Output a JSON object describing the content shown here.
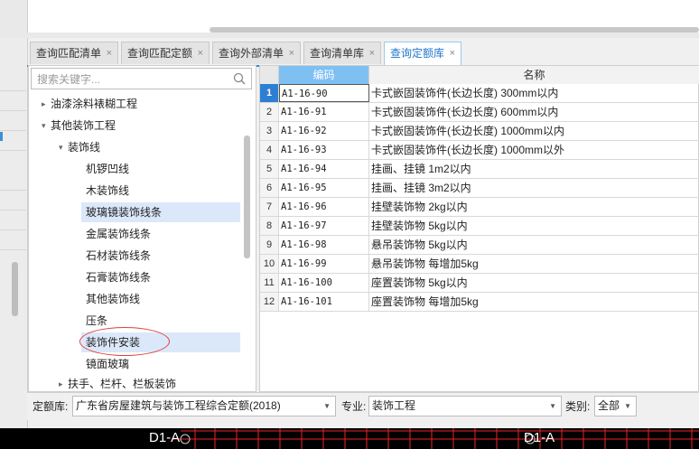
{
  "tabs": [
    {
      "label": "查询匹配清单",
      "active": false
    },
    {
      "label": "查询匹配定额",
      "active": false
    },
    {
      "label": "查询外部清单",
      "active": false
    },
    {
      "label": "查询清单库",
      "active": false
    },
    {
      "label": "查询定额库",
      "active": true
    }
  ],
  "tab_close_glyph": "×",
  "search": {
    "placeholder": "搜索关键字..."
  },
  "tree": [
    {
      "label": "油漆涂料裱糊工程",
      "level": 1,
      "arrow": "▸"
    },
    {
      "label": "其他装饰工程",
      "level": 1,
      "arrow": "▾"
    },
    {
      "label": "装饰线",
      "level": 2,
      "arrow": "▾"
    },
    {
      "label": "机锣凹线",
      "level": 3
    },
    {
      "label": "木装饰线",
      "level": 3
    },
    {
      "label": "玻璃镜装饰线条",
      "level": 3,
      "selected": true
    },
    {
      "label": "金属装饰线条",
      "level": 3
    },
    {
      "label": "石材装饰线条",
      "level": 3
    },
    {
      "label": "石膏装饰线条",
      "level": 3
    },
    {
      "label": "其他装饰线",
      "level": 3
    },
    {
      "label": "压条",
      "level": 3
    },
    {
      "label": "装饰件安装",
      "level": 3,
      "selected": true,
      "circled": true
    },
    {
      "label": "镜面玻璃",
      "level": 3
    },
    {
      "label": "扶手、栏杆、栏板装饰",
      "level": 2,
      "arrow": "▸"
    }
  ],
  "grid": {
    "headers": {
      "code": "编码",
      "name": "名称"
    },
    "current_row": 1,
    "rows": [
      {
        "num": "1",
        "code": "A1-16-90",
        "name": "卡式嵌固装饰件(长边长度) 300mm以内"
      },
      {
        "num": "2",
        "code": "A1-16-91",
        "name": "卡式嵌固装饰件(长边长度) 600mm以内"
      },
      {
        "num": "3",
        "code": "A1-16-92",
        "name": "卡式嵌固装饰件(长边长度) 1000mm以内"
      },
      {
        "num": "4",
        "code": "A1-16-93",
        "name": "卡式嵌固装饰件(长边长度) 1000mm以外"
      },
      {
        "num": "5",
        "code": "A1-16-94",
        "name": "挂画、挂镜 1m2以内"
      },
      {
        "num": "6",
        "code": "A1-16-95",
        "name": "挂画、挂镜 3m2以内"
      },
      {
        "num": "7",
        "code": "A1-16-96",
        "name": "挂壁装饰物 2kg以内"
      },
      {
        "num": "8",
        "code": "A1-16-97",
        "name": "挂壁装饰物 5kg以内"
      },
      {
        "num": "9",
        "code": "A1-16-98",
        "name": "悬吊装饰物 5kg以内"
      },
      {
        "num": "10",
        "code": "A1-16-99",
        "name": "悬吊装饰物 每增加5kg"
      },
      {
        "num": "11",
        "code": "A1-16-100",
        "name": "座置装饰物 5kg以内"
      },
      {
        "num": "12",
        "code": "A1-16-101",
        "name": "座置装饰物 每增加5kg"
      }
    ]
  },
  "filter": {
    "quota_label": "定额库:",
    "quota_value": "广东省房屋建筑与装饰工程综合定额(2018)",
    "major_label": "专业:",
    "major_value": "装饰工程",
    "category_label": "类别:",
    "category_value": "全部"
  },
  "cad": {
    "label_left": "D1-A",
    "label_right": "D1-A"
  },
  "colors": {
    "accent": "#2a8ad4",
    "header_code_bg": "#7fc0f3",
    "selection_bg": "#dbe8fa",
    "annotation_circle": "#e0403a"
  }
}
